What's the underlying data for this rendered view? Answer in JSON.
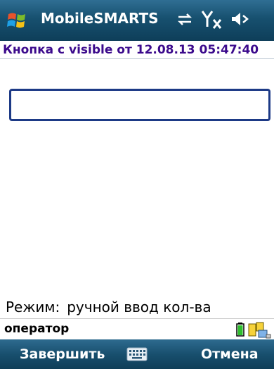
{
  "app": {
    "title": "MobileSMARTS"
  },
  "header": {
    "subtitle": "Кнопка с visible от 12.08.13 05:47:40"
  },
  "main": {
    "input_value": "",
    "mode_label": "Режим:",
    "mode_value": "ручной ввод кол-ва"
  },
  "status": {
    "operator": "оператор"
  },
  "softkeys": {
    "left": "Завершить",
    "right": "Отмена"
  },
  "icons": {
    "start": "windows-start-icon",
    "sync": "sync-arrows-icon",
    "signal": "no-signal-icon",
    "volume": "volume-muted-icon",
    "battery": "battery-icon",
    "devices": "devices-connection-icon",
    "keyboard": "keyboard-icon"
  },
  "colors": {
    "titlebar": "#17506f",
    "subtitle_text": "#3b0a8c",
    "input_border": "#1d3a86"
  }
}
